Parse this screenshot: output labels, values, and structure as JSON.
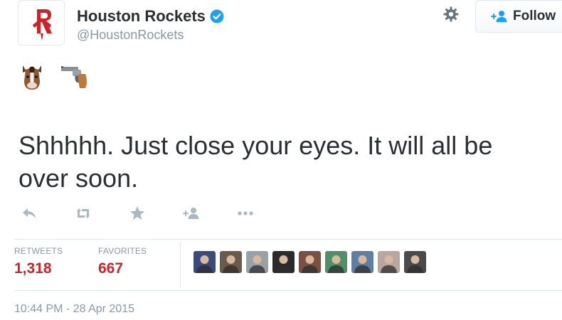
{
  "account": {
    "name": "Houston Rockets",
    "handle": "@HoustonRockets",
    "brand_color": "#cc2228",
    "verified_color": "#1da1f2"
  },
  "header": {
    "follow_label": "Follow",
    "gear_icon": "gear-icon",
    "follow_icon": "follow-person-plus-icon"
  },
  "tweet": {
    "emoji": [
      "horse-face-emoji",
      "pistol-emoji"
    ],
    "text": "Shhhhh. Just close your eyes. It will all be over soon."
  },
  "actions": [
    "reply-icon",
    "retweet-icon",
    "favorite-star-icon",
    "follow-person-plus-icon",
    "more-dots-icon"
  ],
  "stats": {
    "retweets_label": "RETWEETS",
    "retweets_value": "1,318",
    "favorites_label": "FAVORITES",
    "favorites_value": "667"
  },
  "favoriters": [
    {
      "color": "#3a4a7a"
    },
    {
      "color": "#6b5a4a"
    },
    {
      "color": "#9aa0a8"
    },
    {
      "color": "#2a2a2a"
    },
    {
      "color": "#7a5040"
    },
    {
      "color": "#4f8f6a"
    },
    {
      "color": "#5f7fa0"
    },
    {
      "color": "#b8a6a0"
    },
    {
      "color": "#4a4a4a"
    }
  ],
  "timestamp": "10:44 PM - 28 Apr 2015"
}
